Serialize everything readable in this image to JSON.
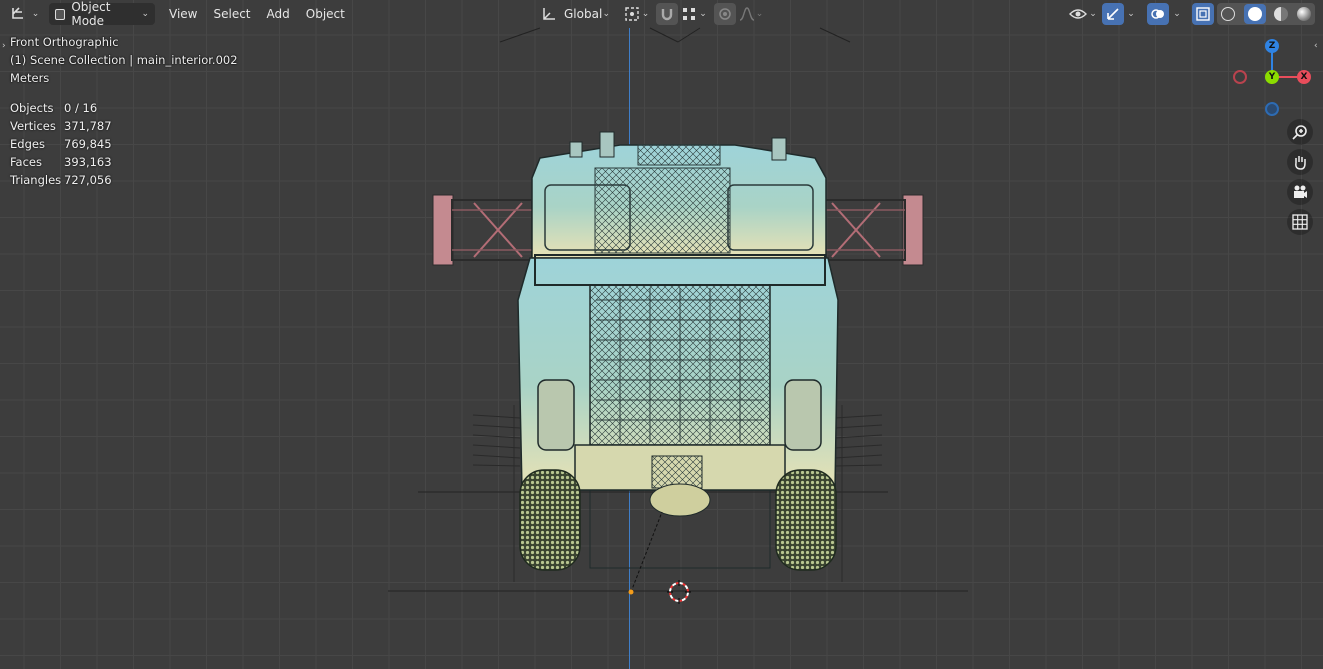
{
  "header": {
    "editor_type_icon": "transform-gizmo-icon",
    "mode": {
      "label": "Object Mode",
      "icon": "object-cube-icon"
    },
    "menus": [
      {
        "id": "view",
        "label": "View"
      },
      {
        "id": "select",
        "label": "Select"
      },
      {
        "id": "add",
        "label": "Add"
      },
      {
        "id": "object",
        "label": "Object"
      }
    ],
    "orientation": {
      "label": "Global",
      "icon": "orientation-axes-icon"
    },
    "pivot_icon": "pivot-point-icon",
    "snap_icon": "snap-magnet-icon",
    "snap_target_icon": "snap-grid-icon",
    "proportional_icon": "proportional-edit-icon",
    "falloff_icon": "falloff-curve-icon",
    "visibility_icon": "eye-visibility-icon",
    "gizmo_icon": "gizmo-toggle-icon",
    "overlay_icon": "overlay-toggle-icon",
    "xray_icon": "xray-toggle-icon",
    "shading_modes": [
      "wireframe",
      "solid",
      "material-preview",
      "rendered"
    ],
    "active_shading": "solid"
  },
  "viewport": {
    "view_name": "Front Orthographic",
    "collection_line": "(1) Scene Collection | main_interior.002",
    "units": "Meters",
    "stats": [
      {
        "label": "Objects",
        "value": "0 / 16"
      },
      {
        "label": "Vertices",
        "value": "371,787"
      },
      {
        "label": "Edges",
        "value": "769,845"
      },
      {
        "label": "Faces",
        "value": "393,163"
      },
      {
        "label": "Triangles",
        "value": "727,056"
      }
    ]
  },
  "gizmo": {
    "z_label": "Z",
    "y_label": "Y",
    "x_label": "X",
    "colors": {
      "x": "#e84d5b",
      "y": "#8bdc00",
      "z": "#2f83e3"
    }
  },
  "nav_buttons": [
    {
      "id": "zoom",
      "icon": "zoom-icon"
    },
    {
      "id": "pan",
      "icon": "hand-pan-icon"
    },
    {
      "id": "camera",
      "icon": "camera-view-icon"
    },
    {
      "id": "ortho",
      "icon": "ortho-grid-icon"
    }
  ],
  "colors": {
    "accent": "#4772b3",
    "z_axis_line": "#3f7ec8",
    "model_tint": "#9fd4d9"
  }
}
